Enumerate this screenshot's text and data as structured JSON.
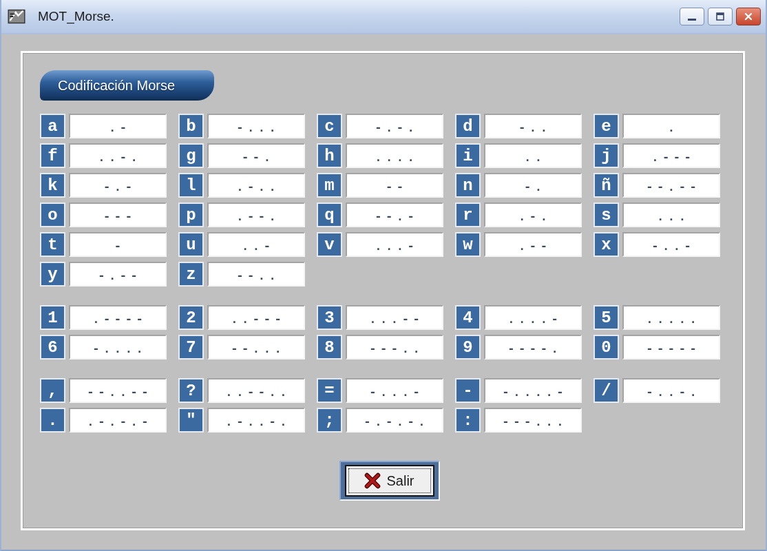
{
  "window": {
    "title": "MOT_Morse."
  },
  "panel": {
    "heading": "Codificación Morse",
    "groups": [
      {
        "items": [
          {
            "symbol": "a",
            "code": ".-"
          },
          {
            "symbol": "b",
            "code": "-..."
          },
          {
            "symbol": "c",
            "code": "-.-."
          },
          {
            "symbol": "d",
            "code": "-.."
          },
          {
            "symbol": "e",
            "code": "."
          },
          {
            "symbol": "f",
            "code": "..-."
          },
          {
            "symbol": "g",
            "code": "--."
          },
          {
            "symbol": "h",
            "code": "...."
          },
          {
            "symbol": "i",
            "code": ".."
          },
          {
            "symbol": "j",
            "code": ".---"
          },
          {
            "symbol": "k",
            "code": "-.-"
          },
          {
            "symbol": "l",
            "code": ".-.."
          },
          {
            "symbol": "m",
            "code": "--"
          },
          {
            "symbol": "n",
            "code": "-."
          },
          {
            "symbol": "ñ",
            "code": "--.--"
          },
          {
            "symbol": "o",
            "code": "---"
          },
          {
            "symbol": "p",
            "code": ".--."
          },
          {
            "symbol": "q",
            "code": "--.-"
          },
          {
            "symbol": "r",
            "code": ".-."
          },
          {
            "symbol": "s",
            "code": "..."
          },
          {
            "symbol": "t",
            "code": "-"
          },
          {
            "symbol": "u",
            "code": "..-"
          },
          {
            "symbol": "v",
            "code": "...-"
          },
          {
            "symbol": "w",
            "code": ".--"
          },
          {
            "symbol": "x",
            "code": "-..-"
          },
          {
            "symbol": "y",
            "code": "-.--"
          },
          {
            "symbol": "z",
            "code": "--.."
          }
        ]
      },
      {
        "items": [
          {
            "symbol": "1",
            "code": ".----"
          },
          {
            "symbol": "2",
            "code": "..---"
          },
          {
            "symbol": "3",
            "code": "...--"
          },
          {
            "symbol": "4",
            "code": "....-"
          },
          {
            "symbol": "5",
            "code": "....."
          },
          {
            "symbol": "6",
            "code": "-...."
          },
          {
            "symbol": "7",
            "code": "--..."
          },
          {
            "symbol": "8",
            "code": "---.."
          },
          {
            "symbol": "9",
            "code": "----."
          },
          {
            "symbol": "0",
            "code": "-----"
          }
        ]
      },
      {
        "items": [
          {
            "symbol": ",",
            "code": "--..--"
          },
          {
            "symbol": "?",
            "code": "..--.."
          },
          {
            "symbol": "=",
            "code": "-...-"
          },
          {
            "symbol": "-",
            "code": "-....-"
          },
          {
            "symbol": "/",
            "code": "-..-."
          },
          {
            "symbol": ".",
            "code": ".-.-.-"
          },
          {
            "symbol": "\"",
            "code": ".-..-."
          },
          {
            "symbol": ";",
            "code": "-.-.-."
          },
          {
            "symbol": ":",
            "code": "---..."
          }
        ]
      }
    ]
  },
  "buttons": [
    {
      "label": "Salir",
      "focused": true
    }
  ]
}
